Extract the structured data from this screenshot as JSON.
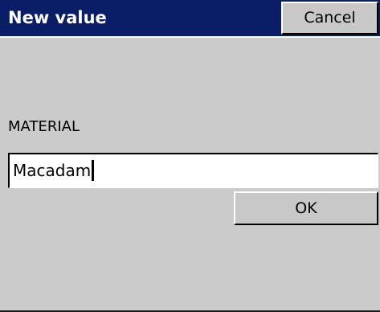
{
  "dialog": {
    "title": "New value",
    "cancel_label": "Cancel",
    "field_label": "MATERIAL",
    "field_value": "Macadam",
    "ok_label": "OK"
  },
  "colors": {
    "titlebar": "#0a1e68",
    "background": "#cbcbcb"
  }
}
